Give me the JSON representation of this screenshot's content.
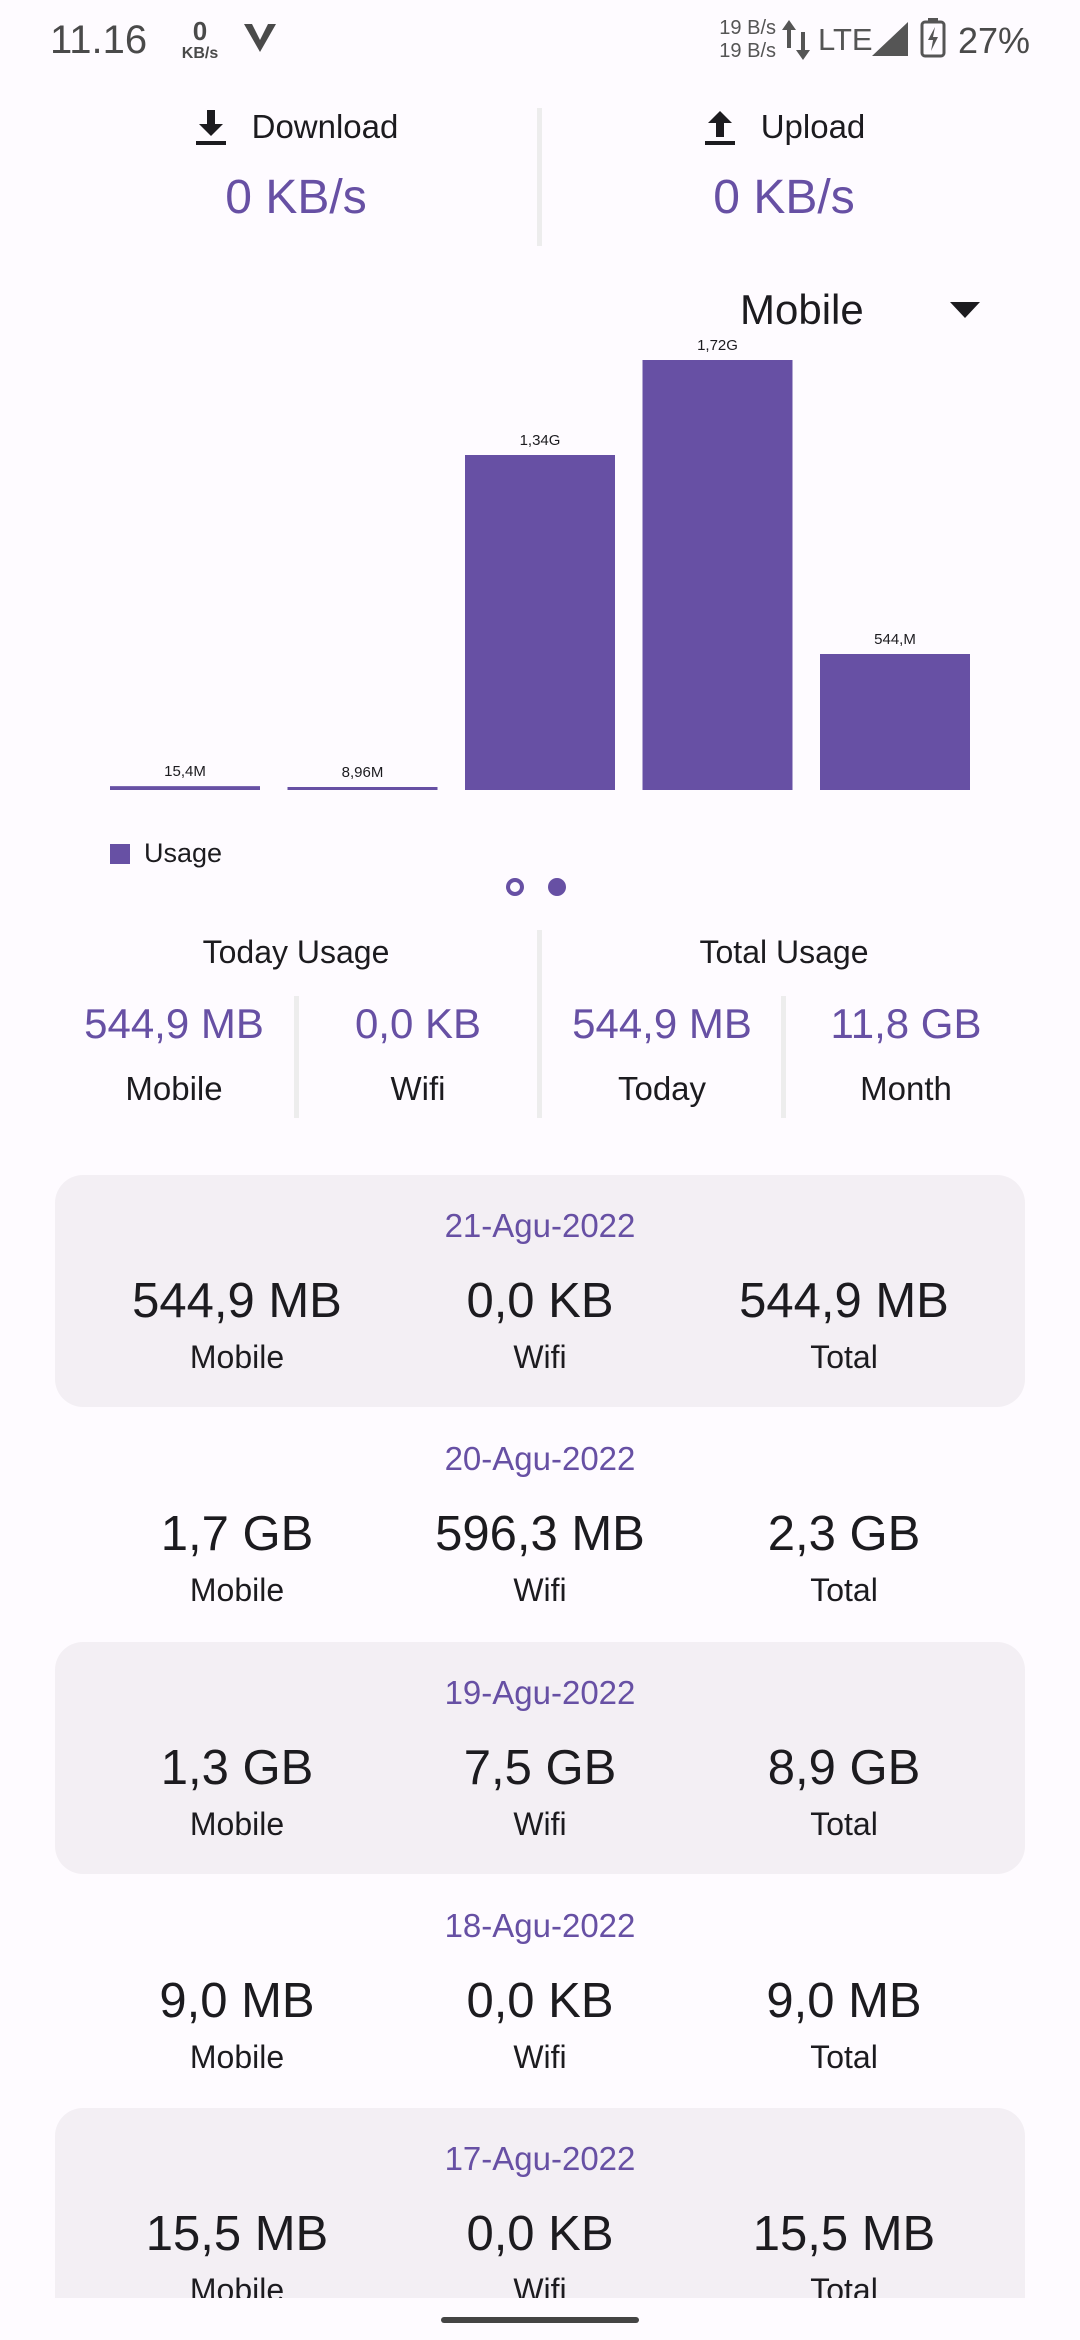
{
  "status_bar": {
    "time": "11.16",
    "net_speed_value": "0",
    "net_speed_unit": "KB/s",
    "rate_up": "19 B/s",
    "rate_down": "19 B/s",
    "network": "LTE",
    "battery": "27%"
  },
  "speed": {
    "download_label": "Download",
    "download_value": "0 KB/s",
    "upload_label": "Upload",
    "upload_value": "0 KB/s"
  },
  "network_select": {
    "selected": "Mobile"
  },
  "chart_data": {
    "type": "bar",
    "categories": [
      "",
      "",
      "",
      "",
      ""
    ],
    "values": [
      15.4,
      8.96,
      1340,
      1720,
      544
    ],
    "value_labels": [
      "15,4M",
      "8,96M",
      "1,34G",
      "1,72G",
      "544,M"
    ],
    "unit": "MB",
    "ylim": [
      0,
      1720
    ],
    "series": [
      {
        "name": "Usage",
        "values": [
          15.4,
          8.96,
          1340,
          1720,
          544
        ]
      }
    ],
    "legend_position": "bottom-left",
    "color": "#6750a4",
    "grid": false
  },
  "pager": {
    "pages": 2,
    "active": 2
  },
  "summary": {
    "today_title": "Today Usage",
    "total_title": "Total Usage",
    "cells": [
      {
        "value": "544,9 MB",
        "label": "Mobile"
      },
      {
        "value": "0,0 KB",
        "label": "Wifi"
      },
      {
        "value": "544,9 MB",
        "label": "Today"
      },
      {
        "value": "11,8 GB",
        "label": "Month"
      }
    ]
  },
  "history": [
    {
      "date": "21-Agu-2022",
      "mobile": "544,9 MB",
      "wifi": "0,0 KB",
      "total": "544,9 MB"
    },
    {
      "date": "20-Agu-2022",
      "mobile": "1,7 GB",
      "wifi": "596,3 MB",
      "total": "2,3 GB"
    },
    {
      "date": "19-Agu-2022",
      "mobile": "1,3 GB",
      "wifi": "7,5 GB",
      "total": "8,9 GB"
    },
    {
      "date": "18-Agu-2022",
      "mobile": "9,0 MB",
      "wifi": "0,0 KB",
      "total": "9,0 MB"
    },
    {
      "date": "17-Agu-2022",
      "mobile": "15,5 MB",
      "wifi": "0,0 KB",
      "total": "15,5 MB"
    }
  ],
  "history_labels": {
    "mobile": "Mobile",
    "wifi": "Wifi",
    "total": "Total"
  },
  "colors": {
    "accent": "#6750a4",
    "card": "#f3eff4",
    "background": "#fefbff"
  },
  "icons": [
    "download-icon",
    "upload-icon",
    "dropdown-arrow-icon",
    "signal-icon",
    "battery-charging-icon",
    "vpn-v-icon",
    "data-arrows-icon"
  ]
}
